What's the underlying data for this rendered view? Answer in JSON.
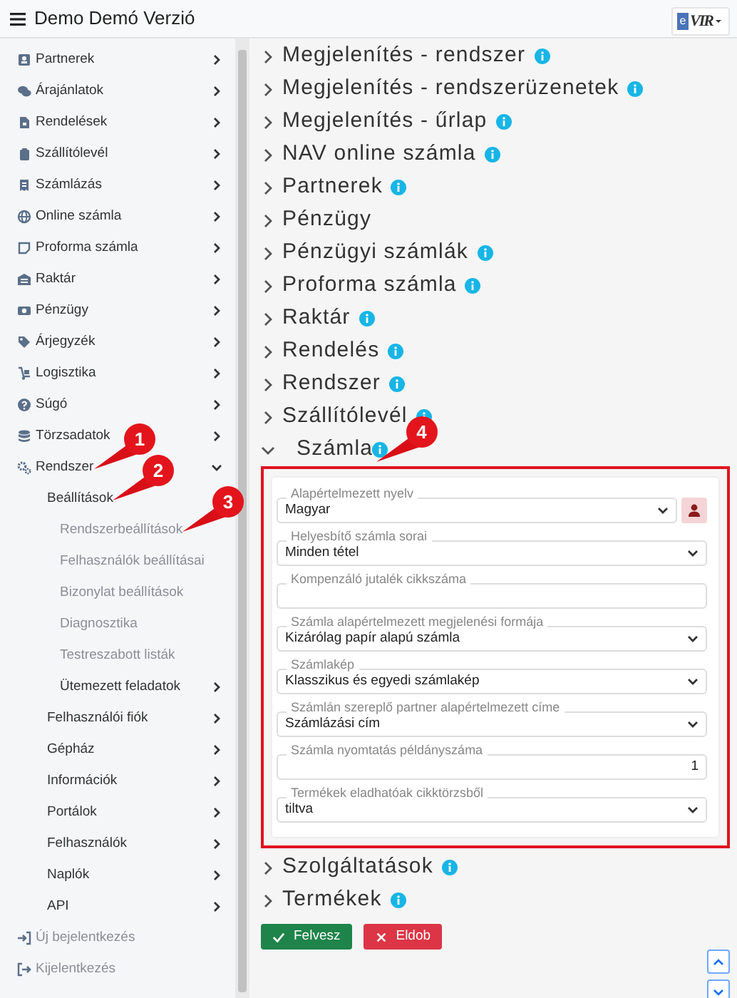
{
  "app_title": "Demo Demó Verzió",
  "logo": {
    "mark": "e",
    "text": "VIR"
  },
  "sidebar": {
    "items": [
      {
        "label": "Partnerek",
        "expanded": false
      },
      {
        "label": "Árajánlatok",
        "expanded": false
      },
      {
        "label": "Rendelések",
        "expanded": false
      },
      {
        "label": "Szállítólevél",
        "expanded": false
      },
      {
        "label": "Számlázás",
        "expanded": false
      },
      {
        "label": "Online számla",
        "expanded": false
      },
      {
        "label": "Proforma számla",
        "expanded": false
      },
      {
        "label": "Raktár",
        "expanded": false
      },
      {
        "label": "Pénzügy",
        "expanded": false
      },
      {
        "label": "Árjegyzék",
        "expanded": false
      },
      {
        "label": "Logisztika",
        "expanded": false
      },
      {
        "label": "Súgó",
        "expanded": false
      },
      {
        "label": "Törzsadatok",
        "expanded": false
      },
      {
        "label": "Rendszer",
        "expanded": true,
        "callout": "1",
        "children": [
          {
            "label": "Beállítások",
            "callout": "2",
            "children": [
              {
                "label": "Rendszerbeállítások",
                "callout": "3"
              },
              {
                "label": "Felhasználók beállításai"
              },
              {
                "label": "Bizonylat beállítások"
              },
              {
                "label": "Diagnosztika"
              },
              {
                "label": "Testreszabott listák"
              },
              {
                "label": "Ütemezett feladatok",
                "expanded": false
              }
            ]
          },
          {
            "label": "Felhasználói fiók",
            "expanded": false
          },
          {
            "label": "Gépház",
            "expanded": false
          },
          {
            "label": "Információk",
            "expanded": false
          },
          {
            "label": "Portálok",
            "expanded": false
          },
          {
            "label": "Felhasználók",
            "expanded": false
          },
          {
            "label": "Naplók",
            "expanded": false
          },
          {
            "label": "API",
            "expanded": false
          }
        ]
      }
    ],
    "footer_links": [
      {
        "label": "Új bejelentkezés"
      },
      {
        "label": "Kijelentkezés"
      }
    ]
  },
  "sections": [
    {
      "title": "Megjelenítés - rendszer",
      "info": true,
      "expanded": false
    },
    {
      "title": "Megjelenítés - rendszerüzenetek",
      "info": true,
      "expanded": false
    },
    {
      "title": "Megjelenítés - űrlap",
      "info": true,
      "expanded": false
    },
    {
      "title": "NAV online számla",
      "info": true,
      "expanded": false
    },
    {
      "title": "Partnerek",
      "info": true,
      "expanded": false
    },
    {
      "title": "Pénzügy",
      "info": false,
      "expanded": false
    },
    {
      "title": "Pénzügyi számlák",
      "info": true,
      "expanded": false
    },
    {
      "title": "Proforma számla",
      "info": true,
      "expanded": false
    },
    {
      "title": "Raktár",
      "info": true,
      "expanded": false
    },
    {
      "title": "Rendelés",
      "info": true,
      "expanded": false
    },
    {
      "title": "Rendszer",
      "info": true,
      "expanded": false
    },
    {
      "title": "Szállítólevél",
      "info": true,
      "expanded": false
    },
    {
      "title": "Számla",
      "info": true,
      "expanded": true,
      "callout": "4",
      "highlighted": true,
      "fields": [
        {
          "label": "Alapértelmezett nyelv",
          "value": "Magyar",
          "kind": "select",
          "user_button": true
        },
        {
          "label": "Helyesbítő számla sorai",
          "value": "Minden tétel",
          "kind": "select"
        },
        {
          "label": "Kompenzáló jutalék cikkszáma",
          "kind": "text"
        },
        {
          "label": "Számla alapértelmezett megjelenési formája",
          "value": "Kizárólag papír alapú számla",
          "kind": "select"
        },
        {
          "label": "Számlakép",
          "value": "Klasszikus és egyedi számlakép",
          "kind": "select"
        },
        {
          "label": "Számlán szereplő partner alapértelmezett címe",
          "value": "Számlázási cím",
          "kind": "select"
        },
        {
          "label": "Számla nyomtatás példányszáma",
          "value": "1",
          "kind": "number"
        },
        {
          "label": "Termékek eladhatóak cikktörzsből",
          "value": "tiltva",
          "kind": "select"
        }
      ]
    },
    {
      "title": "Szolgáltatások",
      "info": true,
      "expanded": false
    },
    {
      "title": "Termékek",
      "info": true,
      "expanded": false
    }
  ],
  "buttons": [
    {
      "label": "Felvesz",
      "kind": "save"
    },
    {
      "label": "Eldob",
      "kind": "discard"
    }
  ]
}
